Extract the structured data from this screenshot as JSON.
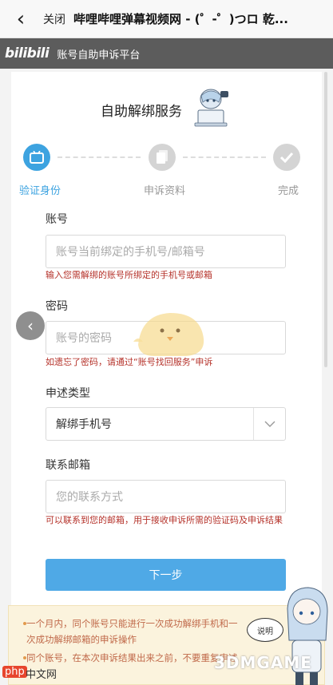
{
  "browser": {
    "back_label": "‹",
    "close_label": "关闭",
    "title": "哔哩哔哩弹幕视频网 - (゜-゜)つロ 乾..."
  },
  "header": {
    "logo": "bilibili",
    "title": "账号自助申诉平台"
  },
  "page": {
    "title": "自助解绑服务"
  },
  "steps": [
    {
      "label": "验证身份",
      "state": "active",
      "color": "#3da3e0"
    },
    {
      "label": "申诉资料",
      "state": "inactive",
      "color": "#d4d4d4"
    },
    {
      "label": "完成",
      "state": "inactive",
      "color": "#d4d4d4"
    }
  ],
  "form": {
    "account": {
      "label": "账号",
      "placeholder": "账号当前绑定的手机号/邮箱号",
      "hint": "输入您需解绑的账号所绑定的手机号或邮箱"
    },
    "password": {
      "label": "密码",
      "placeholder": "账号的密码",
      "hint": "如遗忘了密码，请通过“账号找回服务”申诉"
    },
    "appeal_type": {
      "label": "申述类型",
      "selected": "解绑手机号"
    },
    "email": {
      "label": "联系邮箱",
      "placeholder": "您的联系方式",
      "hint": "可以联系到您的邮箱，用于接收申诉所需的验证码及申诉结果"
    },
    "submit_label": "下一步"
  },
  "notice": {
    "items": [
      "一个月内，同个账号只能进行一次成功解绑手机和一次成功解绑邮箱的申诉操作",
      "同个账号，在本次申诉结果出来之前，不要重复申述"
    ]
  },
  "mascot_bubble": "说明",
  "watermarks": {
    "site": "3DMGAME",
    "php": "php",
    "cn": "中文网"
  },
  "colors": {
    "accent": "#3da3e0",
    "hint": "#b5322a",
    "header_bg": "#5c5c5c",
    "notice_bg": "#fbf3dd"
  }
}
